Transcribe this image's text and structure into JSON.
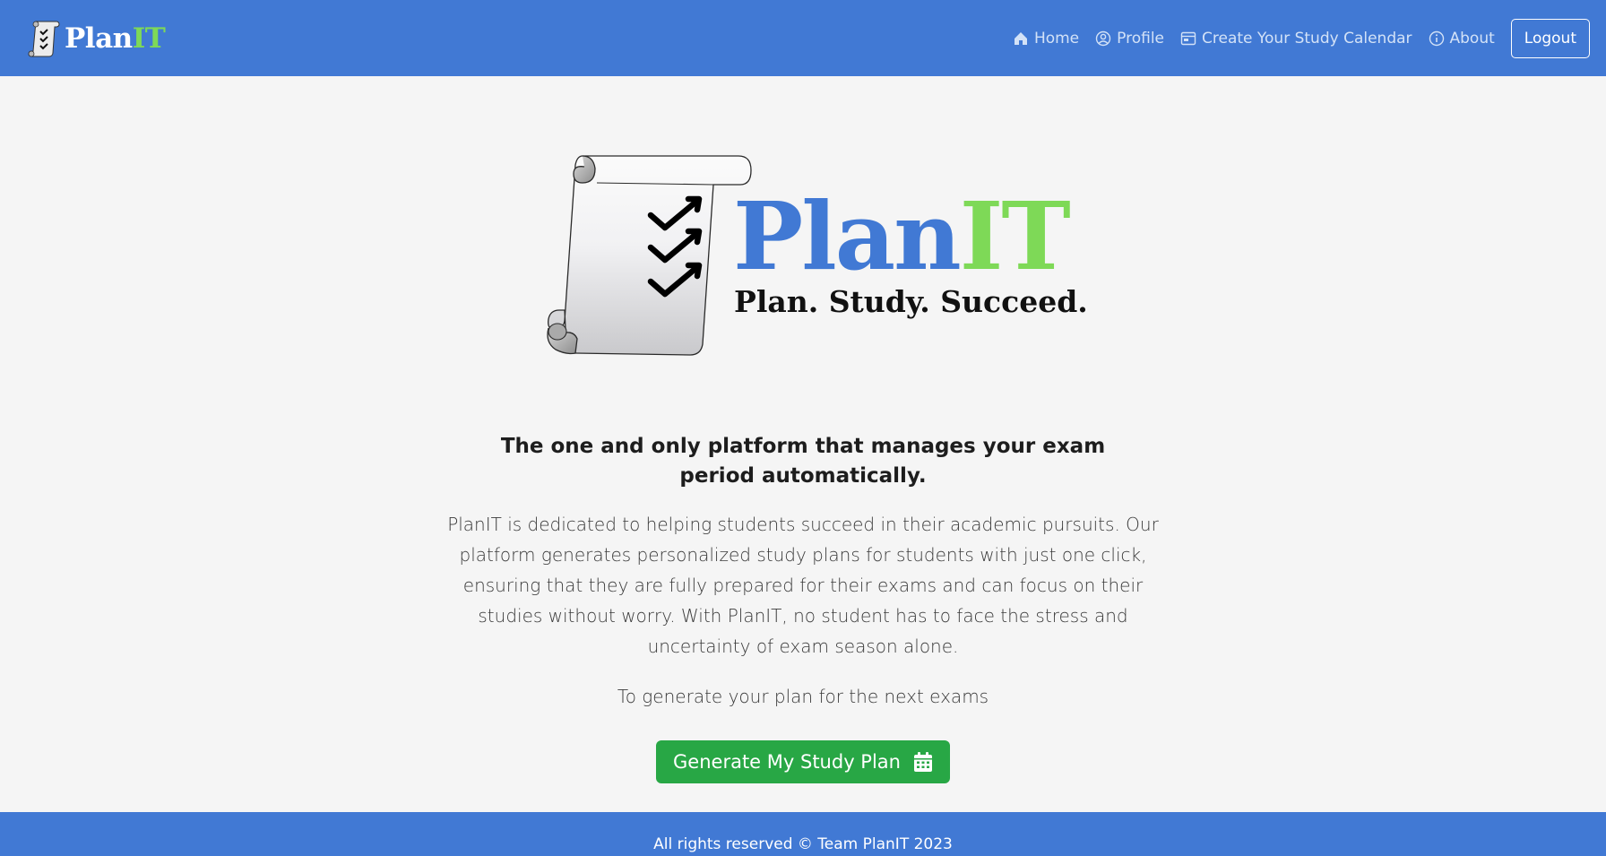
{
  "brand": {
    "name_part1": "Plan",
    "name_part2": "IT",
    "accent_color": "#7ed957",
    "primary_color": "#4179d4"
  },
  "nav": {
    "items": [
      {
        "label": "Home",
        "icon": "home-icon"
      },
      {
        "label": "Profile",
        "icon": "user-circle-icon"
      },
      {
        "label": "Create Your Study Calendar",
        "icon": "calendar-card-icon"
      },
      {
        "label": "About",
        "icon": "info-icon"
      }
    ],
    "logout_label": "Logout"
  },
  "hero": {
    "logo_title_part1": "Plan",
    "logo_title_part2": "IT",
    "tagline": "Plan. Study. Succeed."
  },
  "main": {
    "headline": "The one and only platform that manages your exam period automatically.",
    "description": "PlanIT is dedicated to helping students succeed in their academic pursuits. Our platform generates personalized study plans for students with just one click, ensuring that they are fully prepared for their exams and can focus on their studies without worry. With PlanIT, no student has to face the stress and uncertainty of exam season alone.",
    "cta_text": "To generate your plan for the next exams",
    "generate_button_label": "Generate My Study Plan",
    "button_color": "#28a745"
  },
  "footer": {
    "text": "All rights reserved © Team PlanIT 2023"
  }
}
